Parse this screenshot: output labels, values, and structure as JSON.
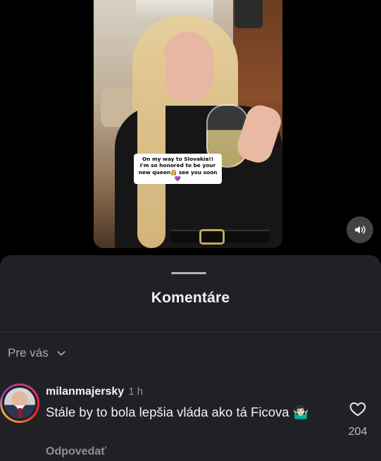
{
  "video": {
    "caption_lines": [
      "On my way to Slovakia!!",
      "I'm so honored to be your",
      "new queen👸 see you soon",
      "💜"
    ],
    "sound_icon": "speaker-icon"
  },
  "sheet": {
    "title": "Komentáre",
    "filter_label": "Pre vás",
    "filter_icon": "chevron-down-icon"
  },
  "comments": [
    {
      "username": "milanmajersky",
      "time": "1 h",
      "text": "Stále by to bola lepšia vláda ako tá Ficova 🤷🏻‍♂️",
      "reply_label": "Odpovedať",
      "like_count": "204",
      "like_icon": "heart-icon"
    }
  ],
  "colors": {
    "background": "#000000",
    "sheet": "#1f2125",
    "text_primary": "#f2f2f2",
    "text_secondary": "#8e9197"
  }
}
